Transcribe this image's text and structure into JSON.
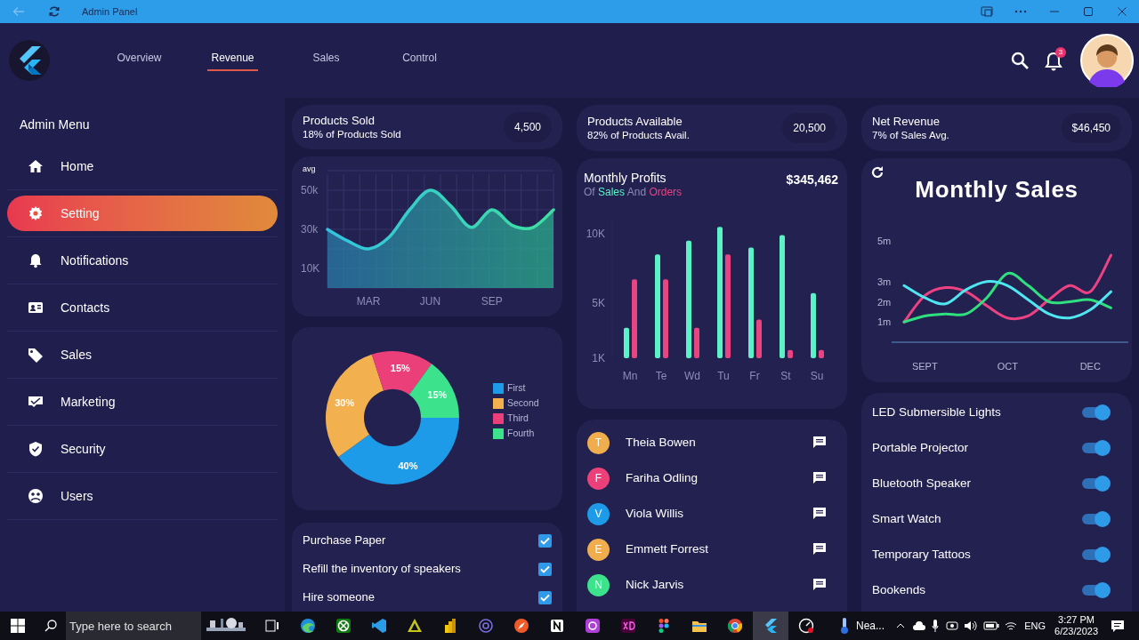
{
  "window": {
    "title": "Admin Panel"
  },
  "header": {
    "tabs": [
      {
        "label": "Overview",
        "selected": false
      },
      {
        "label": "Revenue",
        "selected": true
      },
      {
        "label": "Sales",
        "selected": false
      },
      {
        "label": "Control",
        "selected": false
      }
    ],
    "notification_count": "3"
  },
  "sidebar": {
    "title": "Admin Menu",
    "items": [
      {
        "label": "Home",
        "selected": false
      },
      {
        "label": "Setting",
        "selected": true
      },
      {
        "label": "Notifications",
        "selected": false
      },
      {
        "label": "Contacts",
        "selected": false
      },
      {
        "label": "Sales",
        "selected": false
      },
      {
        "label": "Marketing",
        "selected": false
      },
      {
        "label": "Security",
        "selected": false
      },
      {
        "label": "Users",
        "selected": false
      }
    ]
  },
  "stats": [
    {
      "title": "Products Sold",
      "subtitle": "18% of Products Sold",
      "value": "4,500"
    },
    {
      "title": "Products Available",
      "subtitle": "82% of Products Avail.",
      "value": "20,500"
    },
    {
      "title": "Net Revenue",
      "subtitle": "7% of Sales Avg.",
      "value": "$46,450"
    }
  ],
  "area_chart": {
    "chart_data": {
      "type": "area",
      "ylabel": "avg",
      "grid": true,
      "categories": [
        null,
        null,
        "MAR",
        null,
        null,
        "JUN",
        null,
        null,
        "SEP",
        null,
        null,
        null
      ],
      "values": [
        30,
        24,
        20,
        26,
        40,
        50,
        42,
        31,
        40,
        32,
        31,
        40
      ],
      "ylim": [
        0,
        60
      ],
      "yticks": [
        {
          "value": 10,
          "label": "10K"
        },
        {
          "value": 30,
          "label": "30k"
        },
        {
          "value": 50,
          "label": "50k"
        }
      ]
    }
  },
  "profits": {
    "title": "Monthly Profits",
    "total": "$345,462",
    "subtitle_words": [
      "Of",
      "And"
    ],
    "chart_data": {
      "type": "bar",
      "categories": [
        "Mn",
        "Te",
        "Wd",
        "Tu",
        "Fr",
        "St",
        "Su"
      ],
      "series": [
        {
          "name": "Sales",
          "color": "#5cf2c8",
          "values": [
            3.2,
            8.5,
            9.5,
            10.5,
            9,
            9.9,
            5.7
          ]
        },
        {
          "name": "Orders",
          "color": "#e94482",
          "values": [
            6.7,
            6.7,
            3.2,
            8.5,
            3.8,
            1.6,
            1.6
          ]
        }
      ],
      "ylim": [
        1,
        11
      ],
      "yticks": [
        {
          "value": 1,
          "label": "1K"
        },
        {
          "value": 5,
          "label": "5K"
        },
        {
          "value": 10,
          "label": "10K"
        }
      ]
    }
  },
  "distribution": {
    "chart_data": {
      "type": "donut",
      "categories": [
        "First",
        "Second",
        "Third",
        "Fourth"
      ],
      "values": [
        40,
        30,
        15,
        15
      ],
      "colors": [
        "#1e9be8",
        "#f2b04f",
        "#eb3f7a",
        "#3de28c"
      ],
      "value_labels": [
        "40%",
        "30%",
        "15%",
        "15%"
      ]
    }
  },
  "monthly_sales": {
    "title": "Monthly Sales",
    "chart_data": {
      "type": "line",
      "categories": [
        null,
        "SEPT",
        null,
        null,
        null,
        "OCT",
        null,
        null,
        null,
        "DEC",
        null
      ],
      "series": [
        {
          "color": "#ec4282",
          "values": [
            1.0,
            2.3,
            2.7,
            2.5,
            1.8,
            1.2,
            1.3,
            2.1,
            2.8,
            2.5,
            4.3
          ]
        },
        {
          "color": "#2fe07f",
          "values": [
            1.0,
            1.3,
            1.4,
            1.4,
            2.2,
            3.4,
            2.8,
            2.0,
            2.0,
            2.1,
            1.7
          ]
        },
        {
          "color": "#4ee6f0",
          "values": [
            2.8,
            2.2,
            1.9,
            2.6,
            3.0,
            2.8,
            2.1,
            1.4,
            1.2,
            1.6,
            2.5
          ]
        }
      ],
      "ylim": [
        0,
        5
      ],
      "yticks": [
        {
          "value": 1,
          "label": "1m"
        },
        {
          "value": 2,
          "label": "2m"
        },
        {
          "value": 3,
          "label": "3m"
        },
        {
          "value": 5,
          "label": "5m"
        }
      ]
    }
  },
  "tasks": [
    {
      "label": "Purchase Paper",
      "checked": true
    },
    {
      "label": "Refill the inventory of speakers",
      "checked": true
    },
    {
      "label": "Hire someone",
      "checked": true
    }
  ],
  "contacts": [
    {
      "initial": "T",
      "name": "Theia Bowen",
      "color": "#f0ad4e"
    },
    {
      "initial": "F",
      "name": "Fariha Odling",
      "color": "#ec407a"
    },
    {
      "initial": "V",
      "name": "Viola Willis",
      "color": "#1e9be8"
    },
    {
      "initial": "E",
      "name": "Emmett Forrest",
      "color": "#f0ad4e"
    },
    {
      "initial": "N",
      "name": "Nick Jarvis",
      "color": "#3de28c"
    }
  ],
  "products": [
    {
      "label": "LED Submersible Lights",
      "on": true
    },
    {
      "label": "Portable Projector",
      "on": true
    },
    {
      "label": "Bluetooth Speaker",
      "on": true
    },
    {
      "label": "Smart Watch",
      "on": true
    },
    {
      "label": "Temporary Tattoos",
      "on": true
    },
    {
      "label": "Bookends",
      "on": true
    }
  ],
  "taskbar": {
    "search_placeholder": "Type here to search",
    "weather": "Nea...",
    "language": "ENG",
    "time": "3:27 PM",
    "date": "6/23/2023"
  }
}
